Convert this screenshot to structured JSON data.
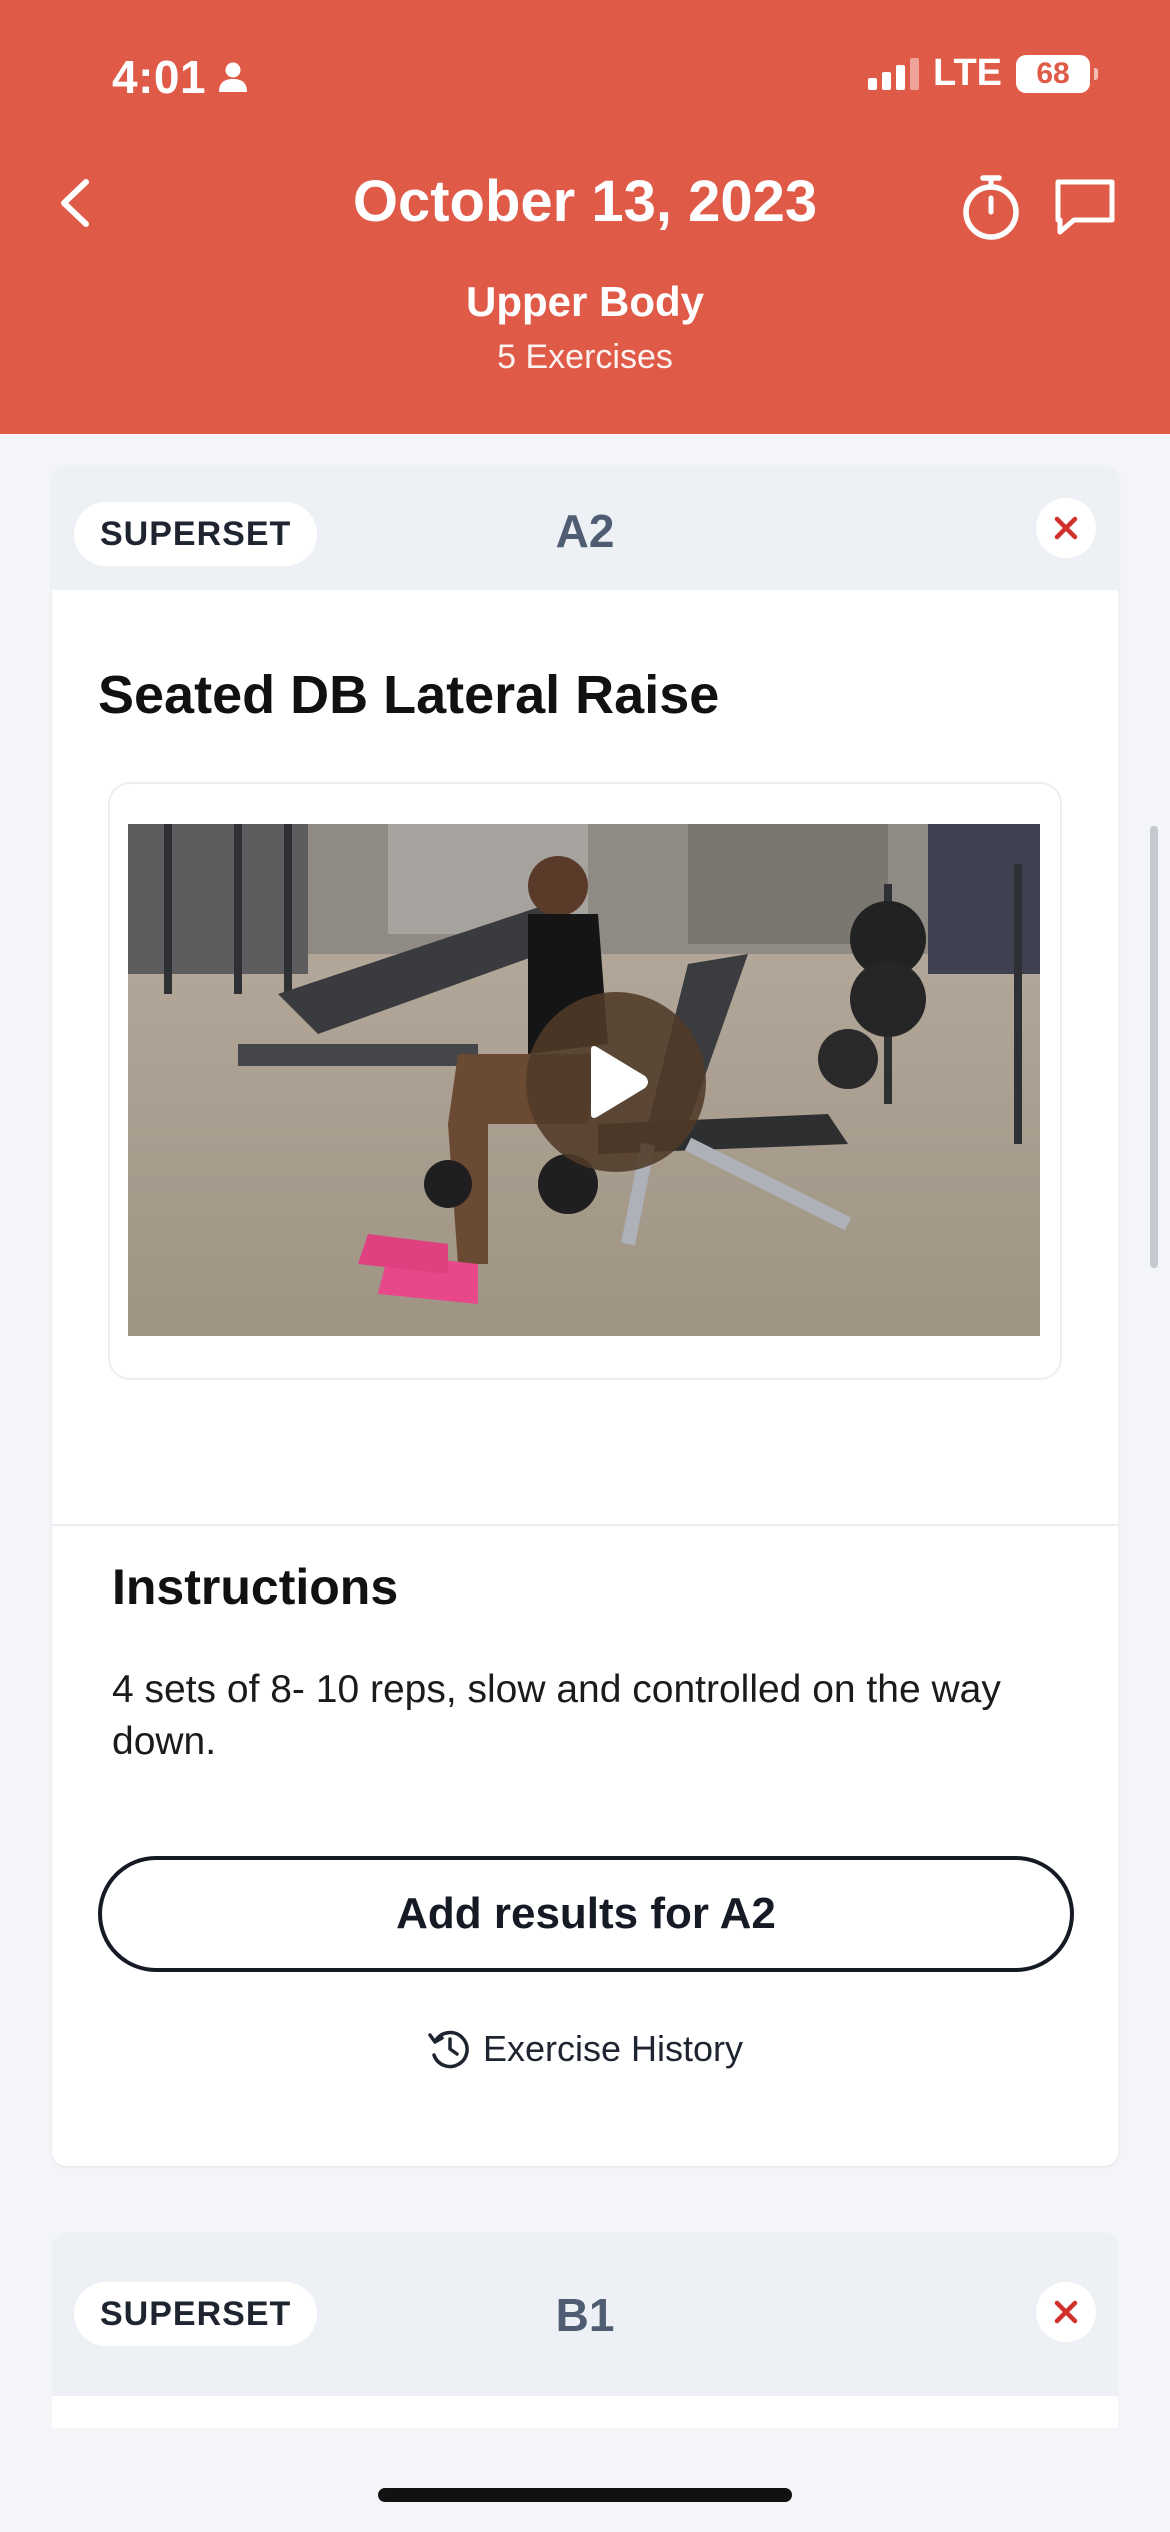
{
  "status_bar": {
    "time": "4:01",
    "network": "LTE",
    "battery": "68"
  },
  "header": {
    "title": "October 13, 2023",
    "workout_name": "Upper Body",
    "exercise_count": "5 Exercises",
    "background_color": "#e05a48"
  },
  "current_group": {
    "badge": "SUPERSET",
    "label": "A2",
    "exercise_title": "Seated DB Lateral Raise",
    "instructions_heading": "Instructions",
    "instructions_text": "4 sets of 8- 10 reps, slow and controlled on the way down.",
    "add_results_label": "Add results for A2",
    "history_label": "Exercise History"
  },
  "next_group": {
    "badge": "SUPERSET",
    "label": "B1"
  },
  "icons": {
    "back": "chevron-left-icon",
    "timer": "stopwatch-icon",
    "chat": "chat-bubble-icon",
    "close": "close-icon",
    "play": "play-icon",
    "history": "history-clock-icon"
  },
  "colors": {
    "accent": "#e05a48",
    "close_x": "#d0312d",
    "group_label": "#4f5d72"
  }
}
